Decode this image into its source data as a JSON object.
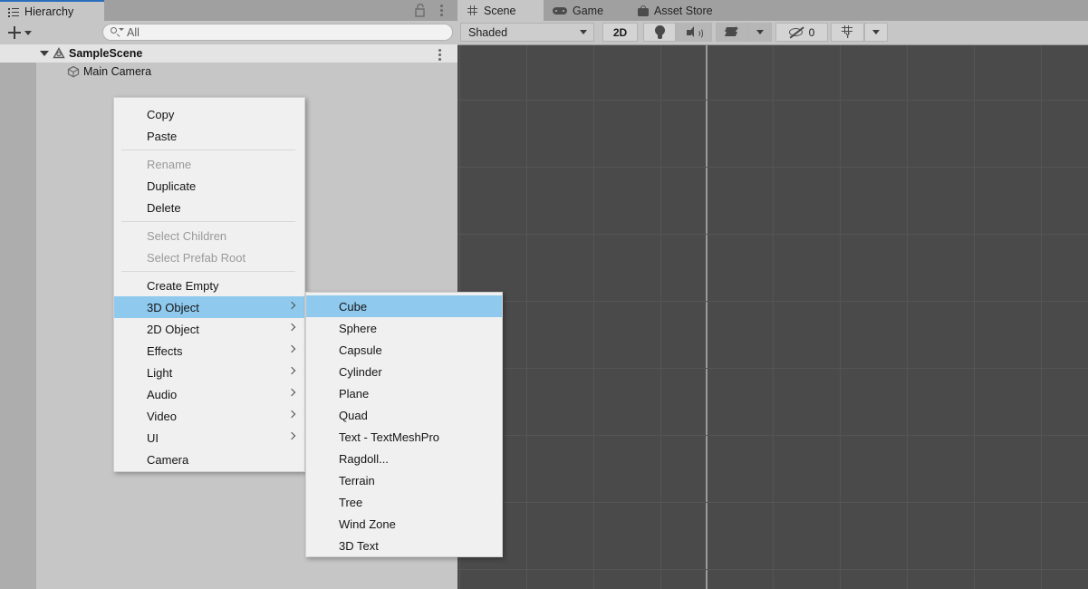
{
  "hierarchy": {
    "tab": {
      "label": "Hierarchy",
      "icon": "hierarchy-icon"
    },
    "lock_icon": "lock-open-icon",
    "kebab_icon": "kebab-menu-icon",
    "toolbar": {
      "add_label": "+",
      "add_caret_icon": "chevron-down-icon",
      "search_placeholder": "All",
      "search_value": "",
      "search_icon": "search-icon"
    },
    "rows": [
      {
        "name": "SampleScene",
        "icon": "unity-scene-icon",
        "expanded": true,
        "bold": true,
        "selected": true
      },
      {
        "name": "Main Camera",
        "icon": "gameobject-cube-icon",
        "expanded": false,
        "bold": false,
        "selected": false
      }
    ]
  },
  "scene_panel": {
    "tabs": [
      {
        "label": "Scene",
        "icon": "hash-grid-icon",
        "active": true
      },
      {
        "label": "Game",
        "icon": "gamepad-icon",
        "active": false
      },
      {
        "label": "Asset Store",
        "icon": "shopping-bag-icon",
        "active": false
      }
    ],
    "toolbar": {
      "draw_mode": "Shaded",
      "draw_mode_caret_icon": "chevron-down-icon",
      "two_d_label": "2D",
      "lighting_icon": "light-bulb-icon",
      "audio_icon": "speaker-icon",
      "fx_icon": "effects-layers-icon",
      "fx_caret_icon": "chevron-down-icon",
      "hidden_objects_icon": "eye-off-icon",
      "hidden_objects_count": "0",
      "gizmos_icon": "gizmo-grid-icon",
      "gizmos_caret_icon": "chevron-down-icon"
    }
  },
  "context_menu": {
    "items": [
      {
        "label": "Copy",
        "disabled": false,
        "submenu": false
      },
      {
        "label": "Paste",
        "disabled": false,
        "submenu": false
      },
      {
        "separator": true
      },
      {
        "label": "Rename",
        "disabled": true,
        "submenu": false
      },
      {
        "label": "Duplicate",
        "disabled": false,
        "submenu": false
      },
      {
        "label": "Delete",
        "disabled": false,
        "submenu": false
      },
      {
        "separator": true
      },
      {
        "label": "Select Children",
        "disabled": true,
        "submenu": false
      },
      {
        "label": "Select Prefab Root",
        "disabled": true,
        "submenu": false
      },
      {
        "separator": true
      },
      {
        "label": "Create Empty",
        "disabled": false,
        "submenu": false
      },
      {
        "label": "3D Object",
        "disabled": false,
        "submenu": true,
        "selected": true
      },
      {
        "label": "2D Object",
        "disabled": false,
        "submenu": true
      },
      {
        "label": "Effects",
        "disabled": false,
        "submenu": true
      },
      {
        "label": "Light",
        "disabled": false,
        "submenu": true
      },
      {
        "label": "Audio",
        "disabled": false,
        "submenu": true
      },
      {
        "label": "Video",
        "disabled": false,
        "submenu": true
      },
      {
        "label": "UI",
        "disabled": false,
        "submenu": true
      },
      {
        "label": "Camera",
        "disabled": false,
        "submenu": false
      }
    ]
  },
  "submenu": {
    "items": [
      {
        "label": "Cube",
        "selected": true
      },
      {
        "label": "Sphere"
      },
      {
        "label": "Capsule"
      },
      {
        "label": "Cylinder"
      },
      {
        "label": "Plane"
      },
      {
        "label": "Quad"
      },
      {
        "label": "Text - TextMeshPro"
      },
      {
        "label": "Ragdoll..."
      },
      {
        "label": "Terrain"
      },
      {
        "label": "Tree"
      },
      {
        "label": "Wind Zone"
      },
      {
        "label": "3D Text"
      }
    ]
  },
  "colors": {
    "panel_bg": "#c6c6c6",
    "tabstrip_bg": "#a0a0a0",
    "menu_bg": "#f0f0f0",
    "highlight": "#8fcaee",
    "scene_bg": "#4a4a4a",
    "grid_line": "#555555",
    "accent_tab": "#2a6ebb"
  }
}
